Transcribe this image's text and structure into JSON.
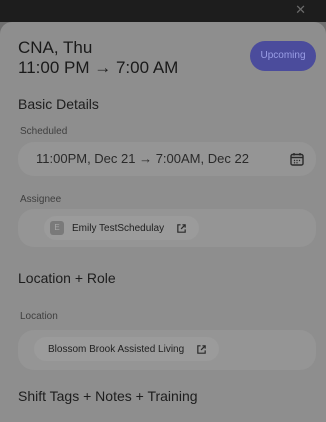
{
  "shift": {
    "title_line1": "CNA, Thu",
    "title_line2": "11:00 PM → 7:00 AM",
    "status": "Upcoming",
    "close_glyph": "✕"
  },
  "basic_details": {
    "heading": "Basic Details",
    "scheduled_label": "Scheduled",
    "scheduled_value": "11:00PM, Dec 21 → 7:00AM, Dec 22",
    "assignee_label": "Assignee",
    "assignee_initial": "E",
    "assignee_name": "Emily TestSchedulay"
  },
  "location_role": {
    "heading": "Location + Role",
    "location_label": "Location",
    "location_value": "Blossom Brook Assisted Living"
  },
  "shift_tags": {
    "heading": "Shift Tags + Notes + Training"
  },
  "colors": {
    "badge_bg": "#4b4c9c",
    "badge_text": "#9a9ee6",
    "sheet_bg": "#8e8e8e",
    "field_bg": "#959595"
  },
  "icons": [
    "close-icon",
    "calendar-icon",
    "external-link-icon"
  ]
}
